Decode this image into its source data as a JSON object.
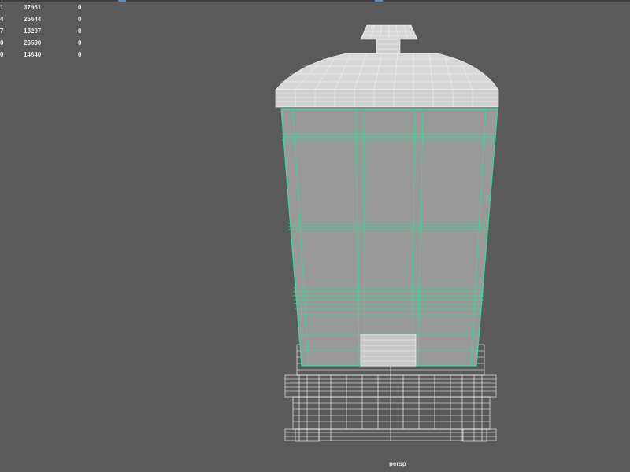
{
  "viewport": {
    "camera_label": "persp",
    "background_color": "#5a5a5a"
  },
  "hud_stats": {
    "rows": [
      {
        "id": "1",
        "value": "37961",
        "extra": "0"
      },
      {
        "id": "4",
        "value": "26644",
        "extra": "0"
      },
      {
        "id": "7",
        "value": "13297",
        "extra": "0"
      },
      {
        "id": "0",
        "value": "26530",
        "extra": "0"
      },
      {
        "id": "0",
        "value": "14640",
        "extra": "0"
      }
    ]
  },
  "model": {
    "wireframe_color": "#ffffff",
    "selection_color": "#2de0a0",
    "body_fill_color": "#9a9a9a"
  }
}
